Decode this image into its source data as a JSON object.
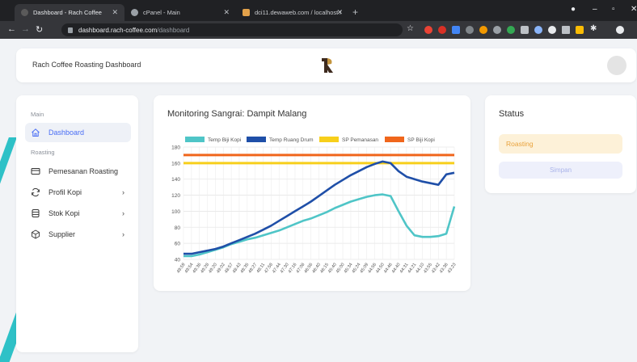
{
  "browser": {
    "tabs": [
      {
        "title": "Dashboard - Rach Coffee",
        "active": true
      },
      {
        "title": "cPanel - Main",
        "active": false
      },
      {
        "title": "dci11.dewaweb.com / localhost /",
        "active": false
      }
    ],
    "url_host": "dashboard.rach-coffee.com",
    "url_path": "/dashboard"
  },
  "header": {
    "title": "Rach Coffee Roasting Dashboard",
    "logo_letter": "R"
  },
  "sidebar": {
    "section_main": "Main",
    "section_roasting": "Roasting",
    "items": [
      {
        "label": "Dashboard",
        "icon": "home-icon",
        "active": true
      },
      {
        "label": "Pemesanan Roasting",
        "icon": "credit-card-icon"
      },
      {
        "label": "Profil Kopi",
        "icon": "refresh-icon",
        "chevron": "›"
      },
      {
        "label": "Stok Kopi",
        "icon": "database-icon",
        "chevron": "›"
      },
      {
        "label": "Supplier",
        "icon": "box-icon",
        "chevron": "›"
      }
    ]
  },
  "chart_card": {
    "title": "Monitoring Sangrai: Dampit Malang"
  },
  "status": {
    "title": "Status",
    "badge": "Roasting",
    "save_label": "Simpan"
  },
  "colors": {
    "teal": "#4fc5c7",
    "blue": "#1f4fa8",
    "yellow": "#f7cf1b",
    "orange": "#f0661c",
    "accent": "#4a6ef5"
  },
  "chart_data": {
    "type": "line",
    "ylim": [
      40,
      180
    ],
    "yticks": [
      40,
      60,
      80,
      100,
      120,
      140,
      160,
      180
    ],
    "x": [
      "49:59",
      "49:54",
      "49:36",
      "49:28",
      "49:20",
      "49:02",
      "48:57",
      "48:43",
      "48:35",
      "48:27",
      "48:11",
      "47:58",
      "47:44",
      "47:30",
      "47:16",
      "47:08",
      "46:56",
      "46:40",
      "46:15",
      "45:40",
      "45:00",
      "45:34",
      "45:24",
      "45:09",
      "44:56",
      "44:50",
      "44:46",
      "44:40",
      "44:31",
      "44:21",
      "44:10",
      "43:55",
      "43:42",
      "43:36",
      "43:23"
    ],
    "series": [
      {
        "name": "Temp Biji Kopi",
        "color": "#4fc5c7",
        "values": [
          44,
          44,
          46,
          49,
          52,
          55,
          59,
          62,
          65,
          67,
          70,
          73,
          76,
          80,
          84,
          88,
          91,
          95,
          99,
          104,
          108,
          112,
          115,
          118,
          120,
          121,
          119,
          100,
          82,
          70,
          68,
          68,
          69,
          72,
          106
        ]
      },
      {
        "name": "Temp Ruang Drum",
        "color": "#1f4fa8",
        "values": [
          47,
          47,
          49,
          51,
          53,
          56,
          60,
          64,
          68,
          72,
          77,
          82,
          88,
          94,
          100,
          106,
          112,
          119,
          126,
          133,
          139,
          145,
          150,
          155,
          159,
          162,
          160,
          150,
          143,
          140,
          137,
          135,
          133,
          146,
          148
        ]
      },
      {
        "name": "SP Pemanasan",
        "color": "#f7cf1b",
        "values": [
          160,
          160,
          160,
          160,
          160,
          160,
          160,
          160,
          160,
          160,
          160,
          160,
          160,
          160,
          160,
          160,
          160,
          160,
          160,
          160,
          160,
          160,
          160,
          160,
          160,
          160,
          160,
          160,
          160,
          160,
          160,
          160,
          160,
          160,
          160
        ]
      },
      {
        "name": "SP Biji Kopi",
        "color": "#f0661c",
        "values": [
          170,
          170,
          170,
          170,
          170,
          170,
          170,
          170,
          170,
          170,
          170,
          170,
          170,
          170,
          170,
          170,
          170,
          170,
          170,
          170,
          170,
          170,
          170,
          170,
          170,
          170,
          170,
          170,
          170,
          170,
          170,
          170,
          170,
          170,
          170
        ]
      }
    ]
  }
}
